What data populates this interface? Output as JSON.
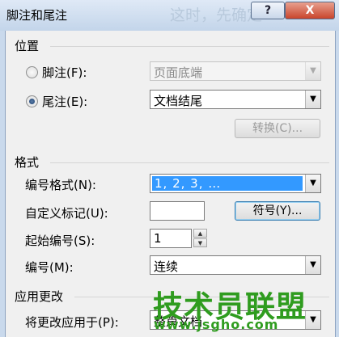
{
  "window": {
    "title": "脚注和尾注",
    "help_label": "?",
    "close_label": "X",
    "ghost_text": "这时，先确定"
  },
  "location": {
    "group_label": "位置",
    "footnote": {
      "label": "脚注(F):",
      "selected": false,
      "position_value": "页面底端",
      "enabled": false
    },
    "endnote": {
      "label": "尾注(E):",
      "selected": true,
      "position_value": "文档结尾"
    },
    "convert_label": "转换(C)..."
  },
  "format": {
    "group_label": "格式",
    "number_format_label": "编号格式(N):",
    "number_format_value": "1, 2, 3, …",
    "custom_mark_label": "自定义标记(U):",
    "custom_mark_value": "",
    "symbol_label": "符号(Y)...",
    "start_at_label": "起始编号(S):",
    "start_at_value": "1",
    "numbering_label": "编号(M):",
    "numbering_value": "连续"
  },
  "apply": {
    "group_label": "应用更改",
    "apply_to_label": "将更改应用于(P):",
    "apply_to_value": "整篇文档"
  },
  "watermark": {
    "text": "技术员联盟",
    "url": "www.jsgho.com",
    "color": "#2f9c1f"
  },
  "colors": {
    "accent_selection": "#3399ff",
    "close_red": "#c9452c"
  }
}
